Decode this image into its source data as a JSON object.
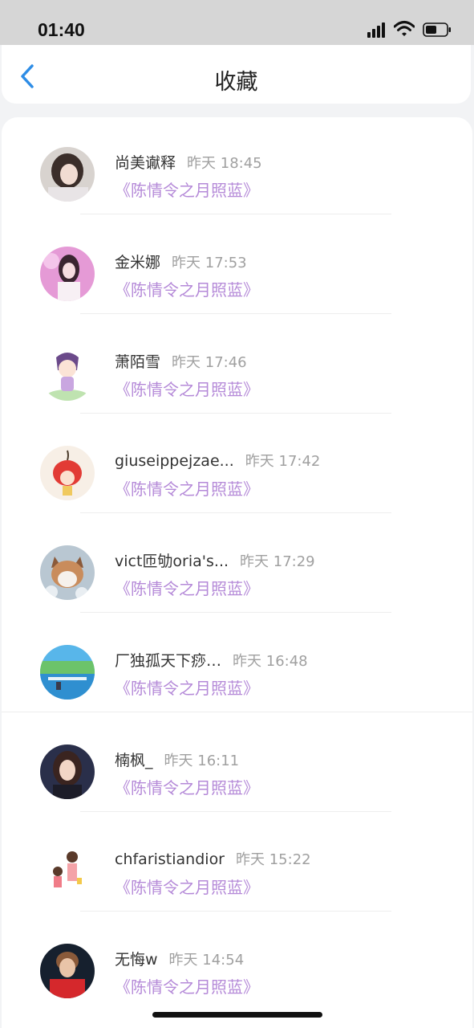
{
  "status": {
    "time": "01:40"
  },
  "header": {
    "title": "收藏",
    "back_icon": "chevron-left-icon",
    "accent": "#2e8de6"
  },
  "colors": {
    "work_link": "#b58ad8",
    "time_text": "#a0a0a0"
  },
  "items": [
    {
      "name": "尚美谳释",
      "time": "昨天 18:45",
      "work": "《陈情令之月照蓝》",
      "avatar": "girl-photo-avatar"
    },
    {
      "name": "金米娜",
      "time": "昨天 17:53",
      "work": "《陈情令之月照蓝》",
      "avatar": "pink-girl-photo-avatar"
    },
    {
      "name": "萧陌雪",
      "time": "昨天 17:46",
      "work": "《陈情令之月照蓝》",
      "avatar": "cartoon-girl-avatar"
    },
    {
      "name": "giuseippejzae...",
      "time": "昨天 17:42",
      "work": "《陈情令之月照蓝》",
      "avatar": "cherry-cartoon-avatar"
    },
    {
      "name": "vict匝劬oria's...",
      "time": "昨天 17:29",
      "work": "《陈情令之月照蓝》",
      "avatar": "cat-photo-avatar"
    },
    {
      "name": "厂独孤天下痧…",
      "time": "昨天 16:48",
      "work": "《陈情令之月照蓝》",
      "avatar": "anime-scenery-avatar"
    },
    {
      "name": "楠枫_",
      "time": "昨天 16:11",
      "work": "《陈情令之月照蓝》",
      "avatar": "woman-photo-avatar"
    },
    {
      "name": "chfaristiandior",
      "time": "昨天 15:22",
      "work": "《陈情令之月照蓝》",
      "avatar": "cartoon-mother-child-avatar"
    },
    {
      "name": "无悔w",
      "time": "昨天 14:54",
      "work": "《陈情令之月照蓝》",
      "avatar": "man-photo-avatar"
    }
  ]
}
